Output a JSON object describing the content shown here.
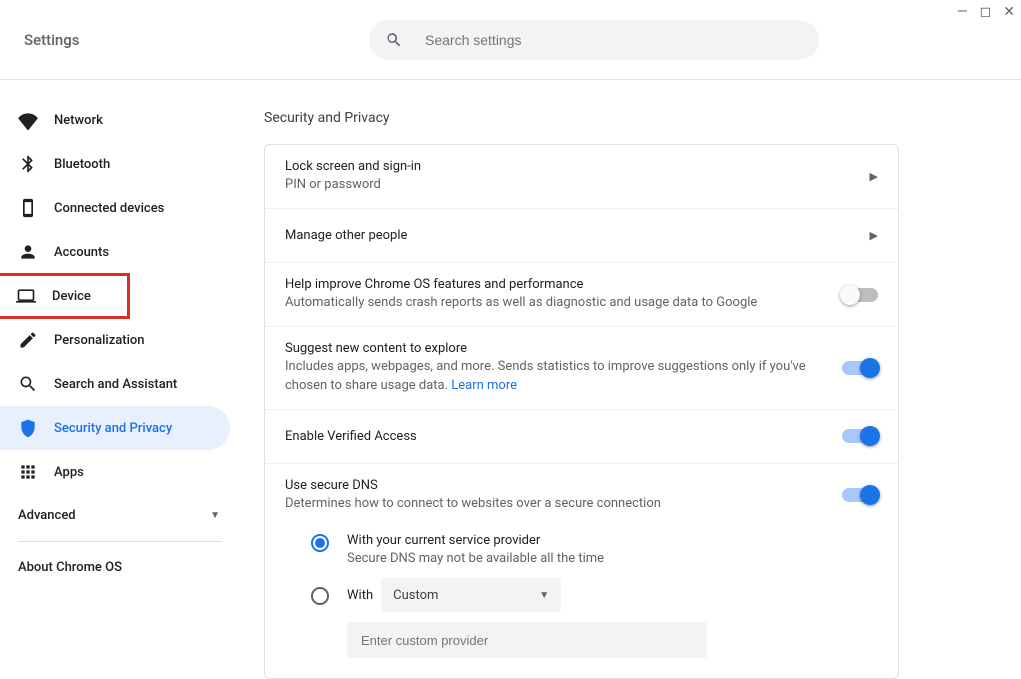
{
  "window": {
    "title": "Settings"
  },
  "search": {
    "placeholder": "Search settings"
  },
  "sidebar": {
    "items": [
      {
        "label": "Network"
      },
      {
        "label": "Bluetooth"
      },
      {
        "label": "Connected devices"
      },
      {
        "label": "Accounts"
      },
      {
        "label": "Device"
      },
      {
        "label": "Personalization"
      },
      {
        "label": "Search and Assistant"
      },
      {
        "label": "Security and Privacy"
      },
      {
        "label": "Apps"
      }
    ],
    "advanced": "Advanced",
    "about": "About Chrome OS"
  },
  "section": {
    "title": "Security and Privacy",
    "rows": {
      "lock": {
        "title": "Lock screen and sign-in",
        "sub": "PIN or password"
      },
      "people": {
        "title": "Manage other people"
      },
      "crash": {
        "title": "Help improve Chrome OS features and performance",
        "sub": "Automatically sends crash reports as well as diagnostic and usage data to Google",
        "on": false
      },
      "suggest": {
        "title": "Suggest new content to explore",
        "sub": "Includes apps, webpages, and more. Sends statistics to improve suggestions only if you've chosen to share usage data.  ",
        "link": "Learn more",
        "on": true
      },
      "verified": {
        "title": "Enable Verified Access",
        "on": true
      },
      "dns": {
        "title": "Use secure DNS",
        "sub": "Determines how to connect to websites over a secure connection",
        "on": true,
        "opt1": {
          "label": "With your current service provider",
          "sub": "Secure DNS may not be available all the time",
          "selected": true
        },
        "opt2": {
          "label": "With",
          "selected": false,
          "select_value": "Custom",
          "input_placeholder": "Enter custom provider"
        }
      }
    }
  }
}
